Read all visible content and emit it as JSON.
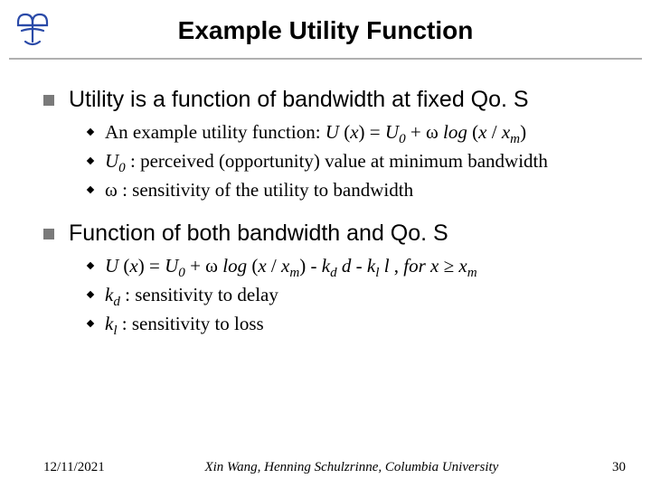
{
  "title": "Example Utility Function",
  "sections": [
    {
      "heading": "Utility is a function of bandwidth at fixed Qo. S",
      "items": [
        {
          "pre": "An example utility function: ",
          "eq_html": "<span class='ital'>U</span> (<span class='ital'>x</span>) = <span class='ital'>U</span><sub>0</sub> + ω <span class='ital'>log</span> (<span class='ital'>x</span> / <span class='ital'>x</span><sub>m</sub>)"
        },
        {
          "eq_html": "<span class='ital'>U</span><sub>0</sub> :",
          "post": " perceived (opportunity) value at minimum bandwidth"
        },
        {
          "eq_html": "ω :",
          "post": " sensitivity of the utility to bandwidth"
        }
      ]
    },
    {
      "heading": "Function of both bandwidth and Qo. S",
      "items": [
        {
          "eq_html": "<span class='ital'>U</span> (<span class='ital'>x</span>) = <span class='ital'>U</span><sub>0</sub> + ω <span class='ital'>log</span> (<span class='ital'>x</span> / <span class='ital'>x</span><sub>m</sub>) - <span class='ital'>k</span><sub>d</sub> <span class='ital'>d</span> - <span class='ital'>k</span><sub>l</sub> <span class='ital'>l</span> , <span class='ital'>for x</span> ≥ <span class='ital'>x</span><sub>m</sub>"
        },
        {
          "eq_html": "<span class='ital'>k</span><sub>d</sub> :",
          "post": " sensitivity to delay"
        },
        {
          "eq_html": "<span class='ital'>k</span><sub>l</sub> :",
          "post": "  sensitivity to loss"
        }
      ]
    }
  ],
  "footer": {
    "date": "12/11/2021",
    "mid": "Xin Wang, Henning Schulzrinne, Columbia University",
    "page": "30"
  }
}
